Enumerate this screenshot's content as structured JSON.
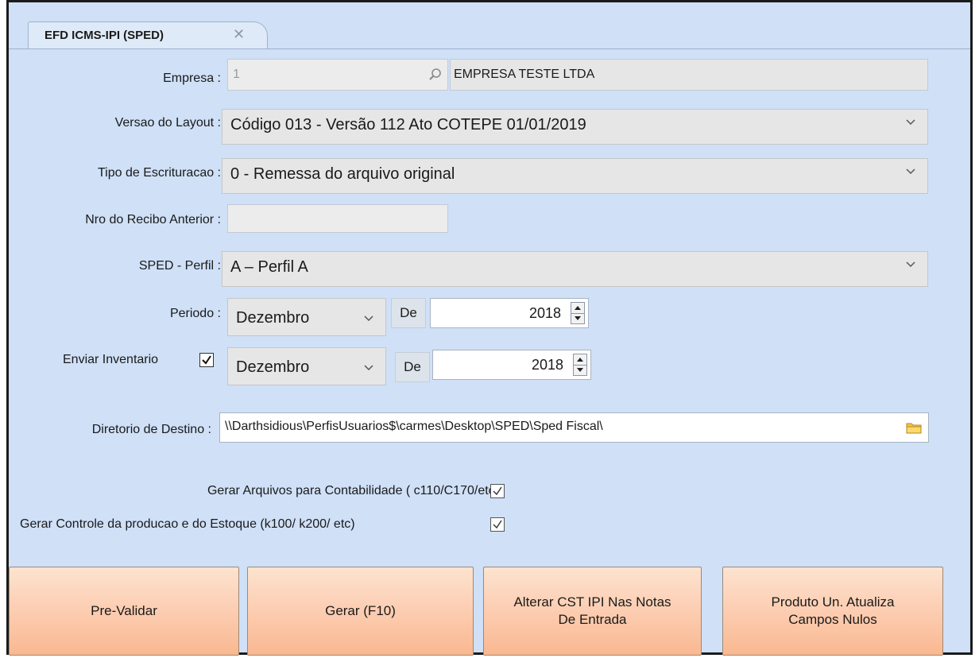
{
  "tab": {
    "label": "EFD ICMS-IPI (SPED)",
    "close": "✕"
  },
  "empresa": {
    "label": "Empresa :",
    "code": "1",
    "name": "EMPRESA TESTE LTDA"
  },
  "versao": {
    "label": "Versao do Layout :",
    "value": "Código 013 - Versão 112 Ato COTEPE 01/01/2019"
  },
  "tipo": {
    "label": "Tipo de Escrituracao :",
    "value": "0 - Remessa do arquivo original"
  },
  "recibo": {
    "label": "Nro do Recibo Anterior :",
    "value": ""
  },
  "perfil": {
    "label": "SPED - Perfil :",
    "value": "A – Perfil A"
  },
  "periodo": {
    "label": "Periodo :",
    "month": "Dezembro",
    "de": "De",
    "year": "2018"
  },
  "inventario": {
    "label": "Enviar Inventario",
    "checked": true,
    "month": "Dezembro",
    "de": "De",
    "year": "2018"
  },
  "diretorio": {
    "label": "Diretorio de Destino :",
    "value": "\\\\Darthsidious\\PerfisUsuarios$\\carmes\\Desktop\\SPED\\Sped Fiscal\\"
  },
  "options": {
    "contabilidade": {
      "label": "Gerar Arquivos para Contabilidade ( c110/C170/etc)",
      "checked": true
    },
    "producao": {
      "label": "Gerar Controle da producao e do Estoque (k100/ k200/ etc)",
      "checked": true
    }
  },
  "buttons": {
    "prevalidar": "Pre-Validar",
    "gerar": "Gerar (F10)",
    "alterar_line1": "Alterar CST IPI Nas Notas",
    "alterar_line2": "De Entrada",
    "produto_line1": "Produto Un. Atualiza",
    "produto_line2": "Campos Nulos"
  },
  "colors": {
    "background": "#cfe0f7",
    "button_top": "#fde3cf",
    "button_bottom": "#f9b891"
  },
  "icons": [
    "close-icon",
    "search-icon",
    "chevron-down-icon",
    "checkbox-icon",
    "folder-icon",
    "spin-up-icon",
    "spin-down-icon"
  ]
}
